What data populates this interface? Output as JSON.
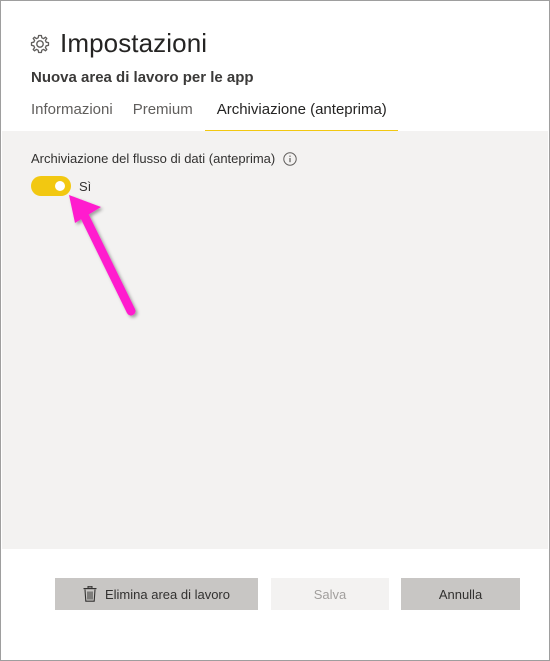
{
  "dialog": {
    "title": "Impostazioni",
    "workspace_name": "Nuova area di lavoro per le app",
    "title_icon": "gear-icon"
  },
  "tabs": [
    {
      "label": "Informazioni",
      "active": false
    },
    {
      "label": "Premium",
      "active": false
    },
    {
      "label": "Archiviazione (anteprima)",
      "active": true
    }
  ],
  "setting": {
    "label": "Archiviazione del flusso di dati (anteprima)",
    "info_icon": "info-icon",
    "toggle_on": true,
    "toggle_text": "Sì"
  },
  "footer": {
    "delete_label": "Elimina area di lavoro",
    "save_label": "Salva",
    "cancel_label": "Annulla"
  },
  "colors": {
    "accent": "#f2c811",
    "annotation_arrow": "#ff1dce",
    "panel_bg": "#f3f2f1"
  }
}
